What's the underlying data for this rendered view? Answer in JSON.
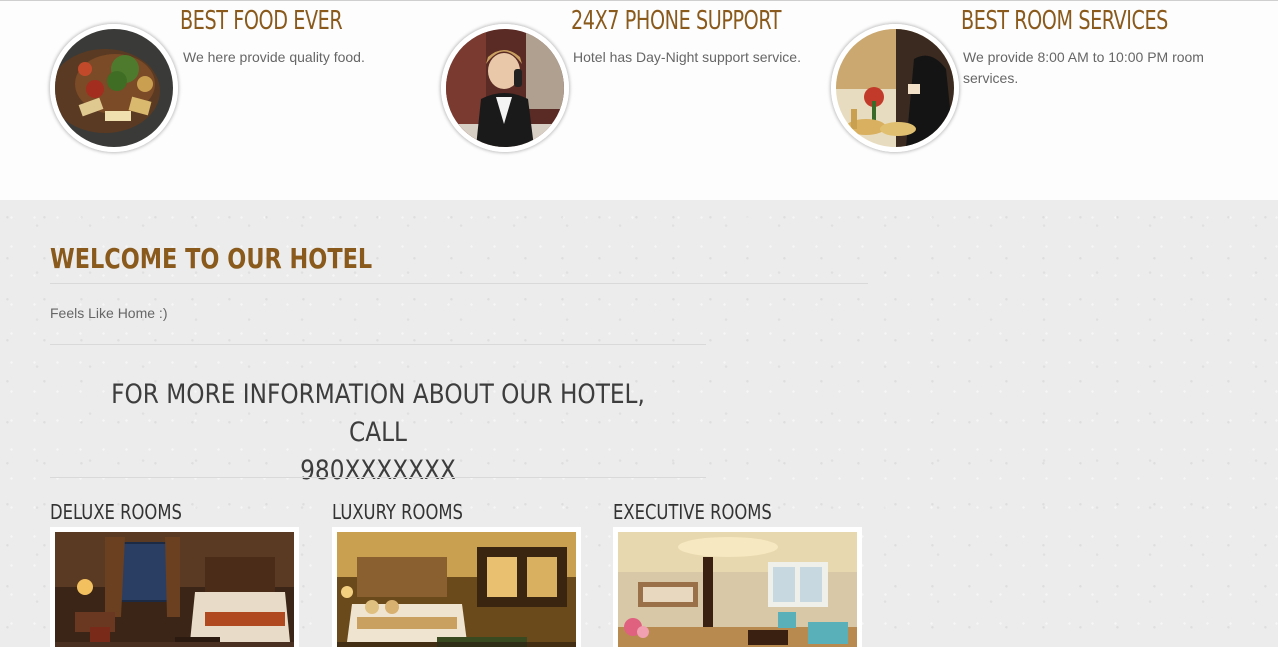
{
  "features": [
    {
      "title": "BEST FOOD EVER",
      "desc": "We here provide quality food.",
      "image": "food-platter-image"
    },
    {
      "title": "24X7 PHONE SUPPORT",
      "desc": "Hotel has Day-Night support service.",
      "image": "receptionist-phone-image"
    },
    {
      "title": "BEST ROOM SERVICES",
      "desc": "We provide 8:00 AM to 10:00 PM room services.",
      "image": "room-service-image"
    }
  ],
  "welcome": {
    "title": "WELCOME TO OUR HOTEL",
    "subtitle": "Feels Like Home :)"
  },
  "info": {
    "line1": "FOR MORE INFORMATION ABOUT OUR HOTEL, CALL",
    "line2": "980XXXXXXX"
  },
  "rooms": [
    {
      "title": "DELUXE ROOMS",
      "image": "deluxe-room-image"
    },
    {
      "title": "LUXURY ROOMS",
      "image": "luxury-room-image"
    },
    {
      "title": "EXECUTIVE ROOMS",
      "image": "executive-room-image"
    }
  ],
  "colors": {
    "accent": "#8a5a1c",
    "text": "#666666",
    "heading_dark": "#333333"
  }
}
